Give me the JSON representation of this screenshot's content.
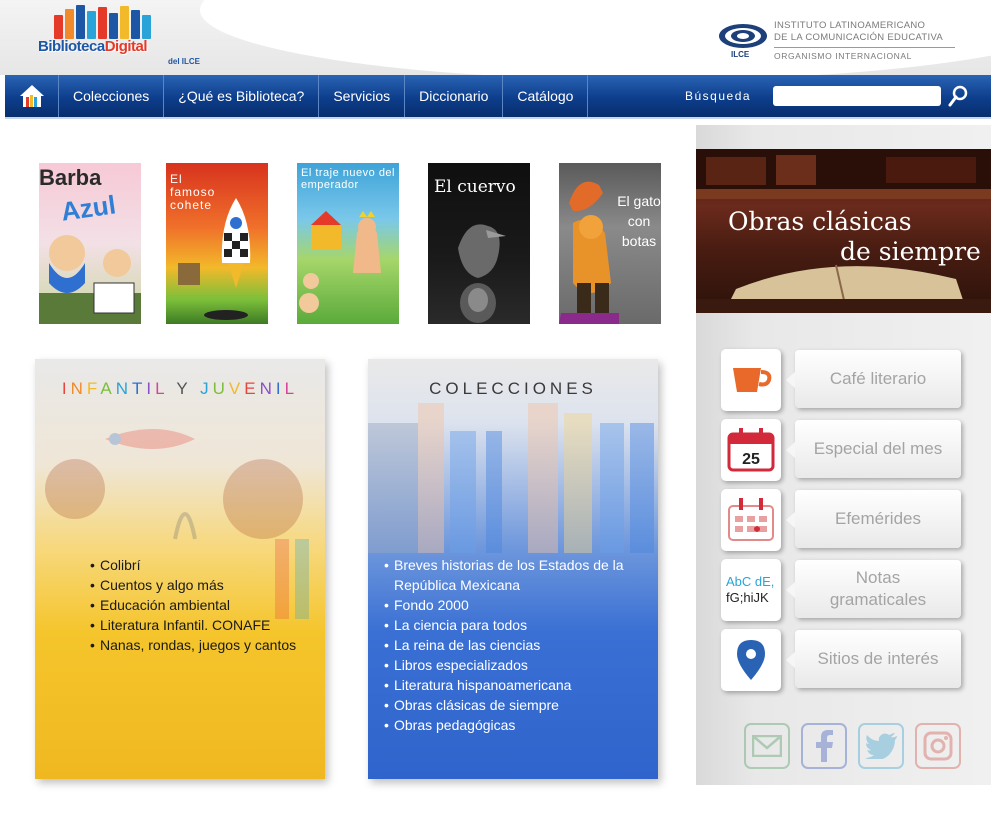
{
  "header": {
    "logo_text_a": "Biblioteca",
    "logo_text_b": "Digital",
    "logo_sub": "del ILCE",
    "org_mark": "ILCE",
    "org_line1": "INSTITUTO LATINOAMERICANO",
    "org_line2": "DE LA COMUNICACIÓN EDUCATIVA",
    "org_line3": "ORGANISMO INTERNACIONAL"
  },
  "nav": {
    "home_icon": "home-icon",
    "items": [
      {
        "label": "Colecciones"
      },
      {
        "label": "¿Qué es Biblioteca?"
      },
      {
        "label": "Servicios"
      },
      {
        "label": "Diccionario"
      },
      {
        "label": "Catálogo"
      }
    ],
    "search_label": "Búsqueda",
    "search_value": ""
  },
  "covers": [
    {
      "title_a": "Barba",
      "title_b": "Azul"
    },
    {
      "title": "El famoso cohete"
    },
    {
      "title": "El traje nuevo del emperador"
    },
    {
      "title": "El cuervo"
    },
    {
      "title": "El gato con botas"
    }
  ],
  "infantil": {
    "title_letters": [
      {
        "ch": "I",
        "color": "#e8453c"
      },
      {
        "ch": "N",
        "color": "#f08a2a"
      },
      {
        "ch": "F",
        "color": "#f2b92a"
      },
      {
        "ch": "A",
        "color": "#7bbf3a"
      },
      {
        "ch": "N",
        "color": "#2aa3d8"
      },
      {
        "ch": "T",
        "color": "#2f6fcf"
      },
      {
        "ch": "I",
        "color": "#8b4fc8"
      },
      {
        "ch": "L",
        "color": "#d8439a"
      },
      {
        "ch": " ",
        "color": "#333333"
      },
      {
        "ch": "Y",
        "color": "#555555"
      },
      {
        "ch": " ",
        "color": "#333333"
      },
      {
        "ch": "J",
        "color": "#2aa3d8"
      },
      {
        "ch": "U",
        "color": "#7bbf3a"
      },
      {
        "ch": "V",
        "color": "#f2b92a"
      },
      {
        "ch": "E",
        "color": "#e8453c"
      },
      {
        "ch": "N",
        "color": "#8b4fc8"
      },
      {
        "ch": "I",
        "color": "#2f6fcf"
      },
      {
        "ch": "L",
        "color": "#d8439a"
      }
    ],
    "items": [
      "Colibrí",
      "Cuentos y algo más",
      "Educación ambiental",
      "Literatura Infantil. CONAFE",
      "Nanas, rondas, juegos y cantos"
    ]
  },
  "colecciones": {
    "title": "COLECCIONES",
    "items": [
      "Breves historias de los Estados de la República Mexicana",
      "Fondo 2000",
      "La ciencia para todos",
      "La reina de las ciencias",
      "Libros especializados",
      "Literatura hispanoamericana",
      "Obras clásicas de siempre",
      "Obras pedagógicas"
    ]
  },
  "banner": {
    "line1": "Obras clásicas",
    "line2": "de siempre"
  },
  "side_links": [
    {
      "label": "Café literario",
      "icon": "coffee-cup-icon"
    },
    {
      "label": "Especial del mes",
      "icon": "calendar-day-icon",
      "day": "25"
    },
    {
      "label": "Efemérides",
      "icon": "calendar-grid-icon"
    },
    {
      "label": "Notas gramaticales",
      "icon": "letters-icon",
      "icon_text_1": "AbC dE,",
      "icon_text_2": "fG;hiJK"
    },
    {
      "label": "Sitios de interés",
      "icon": "map-pin-icon"
    }
  ],
  "socials": [
    {
      "name": "email-icon",
      "color": "#7fb08a"
    },
    {
      "name": "facebook-icon",
      "color": "#6f86c9"
    },
    {
      "name": "twitter-icon",
      "color": "#6fb8d8"
    },
    {
      "name": "instagram-icon",
      "color": "#d8837a"
    }
  ],
  "colors": {
    "nav_blue": "#0d3e8c",
    "accent_red": "#e53a2a",
    "logo_blue": "#1e56a6"
  }
}
